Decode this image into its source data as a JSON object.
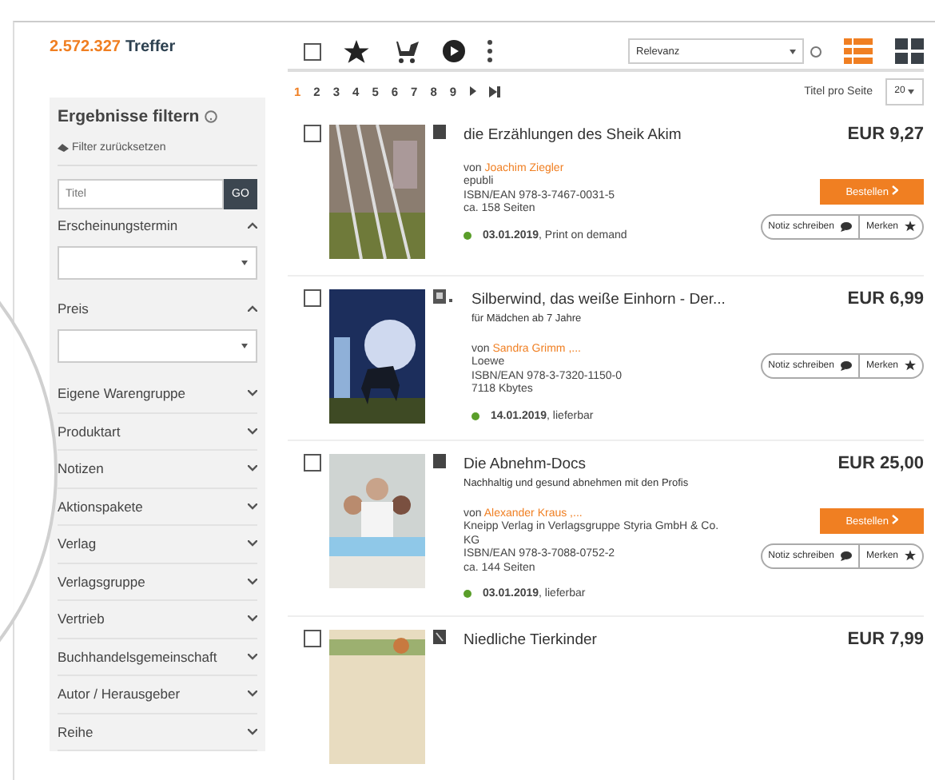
{
  "results": {
    "count": "2.572.327",
    "label": "Treffer"
  },
  "filter": {
    "title": "Ergebnisse filtern",
    "reset": "Filter zurücksetzen",
    "title_field": {
      "placeholder": "Titel"
    },
    "go": "GO",
    "sections": [
      {
        "label": "Erscheinungstermin",
        "expanded": true
      },
      {
        "label": "Preis",
        "expanded": true
      },
      {
        "label": "Eigene Warengruppe",
        "expanded": false
      },
      {
        "label": "Produktart",
        "expanded": false
      },
      {
        "label": "Notizen",
        "expanded": false
      },
      {
        "label": "Aktionspakete",
        "expanded": false
      },
      {
        "label": "Verlag",
        "expanded": false
      },
      {
        "label": "Verlagsgruppe",
        "expanded": false
      },
      {
        "label": "Vertrieb",
        "expanded": false
      },
      {
        "label": "Buchhandelsgemeinschaft",
        "expanded": false
      },
      {
        "label": "Autor / Herausgeber",
        "expanded": false
      },
      {
        "label": "Reihe",
        "expanded": false
      }
    ]
  },
  "toolbar": {
    "select_all": {
      "checked": false
    },
    "sort": "Relevanz",
    "views": [
      {
        "kind": "list",
        "selected": true
      },
      {
        "kind": "grid",
        "selected": false
      }
    ]
  },
  "pagination": {
    "pages": [
      {
        "label": "1",
        "selected": true
      },
      {
        "label": "2",
        "selected": false
      },
      {
        "label": "3",
        "selected": false
      },
      {
        "label": "4",
        "selected": false
      },
      {
        "label": "5",
        "selected": false
      },
      {
        "label": "6",
        "selected": false
      },
      {
        "label": "7",
        "selected": false
      },
      {
        "label": "8",
        "selected": false
      },
      {
        "label": "9",
        "selected": false
      }
    ],
    "per_page_label": "Titel pro Seite",
    "per_page": "20"
  },
  "items": [
    {
      "checked": false,
      "kind": "print",
      "title": "die Erzählungen des Sheik Akim",
      "by": "von",
      "author": "Joachim Ziegler",
      "details": [
        "epubli",
        "ISBN/EAN 978-3-7467-0031-5",
        "ca. 158 Seiten"
      ],
      "availability": "**03.01.2019**, Print on demand",
      "price": "EUR 9,27",
      "order": "Bestellen",
      "note": "Notiz schreiben",
      "remember": "Merken"
    },
    {
      "checked": false,
      "kind": "ebook",
      "title": "Silberwind, das weiße Einhorn - Der...",
      "subtitle": "für Mädchen ab 7 Jahre",
      "by": "von",
      "author": "Sandra Grimm ,...",
      "details": [
        "Loewe",
        "ISBN/EAN 978-3-7320-1150-0",
        "7118 Kbytes"
      ],
      "availability": "**14.01.2019**, lieferbar",
      "price": "EUR 6,99",
      "note": "Notiz schreiben",
      "remember": "Merken"
    },
    {
      "checked": false,
      "kind": "print",
      "title": "Die Abnehm-Docs",
      "subtitle": "Nachhaltig und gesund abnehmen mit den Profis",
      "by": "von",
      "author": "Alexander Kraus ,...",
      "details": [
        "Kneipp Verlag in Verlagsgruppe Styria GmbH & Co. KG",
        "ISBN/EAN 978-3-7088-0752-2",
        "ca. 144 Seiten"
      ],
      "availability": "**03.01.2019**, lieferbar",
      "price": "EUR 25,00",
      "order": "Bestellen",
      "note": "Notiz schreiben",
      "remember": "Merken"
    },
    {
      "checked": false,
      "kind": "other",
      "title": "Niedliche Tierkinder",
      "price": "EUR 7,99"
    }
  ]
}
